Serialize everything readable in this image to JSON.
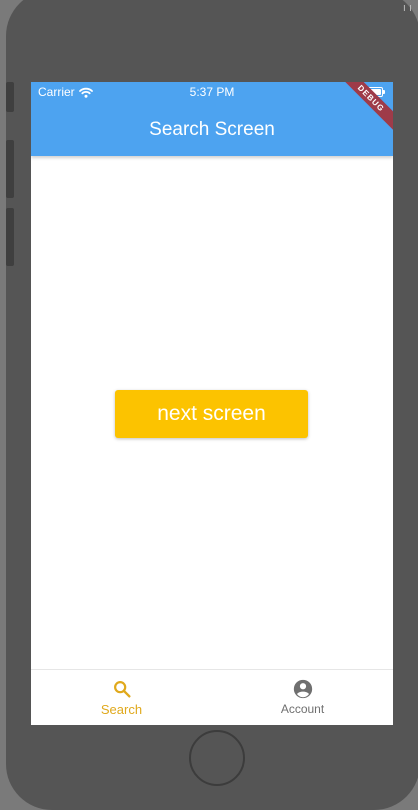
{
  "status_bar": {
    "carrier": "Carrier",
    "time": "5:37 PM"
  },
  "app_bar": {
    "title": "Search Screen"
  },
  "debug_banner": "DEBUG",
  "main": {
    "button_label": "next screen"
  },
  "bottom_nav": {
    "items": [
      {
        "label": "Search",
        "icon": "search-icon",
        "active": true
      },
      {
        "label": "Account",
        "icon": "account-circle-icon",
        "active": false
      }
    ]
  },
  "colors": {
    "app_bar": "#4da3f0",
    "button": "#fcc300",
    "active_tab": "#e0a91c",
    "inactive_tab": "#6f6f6f"
  }
}
